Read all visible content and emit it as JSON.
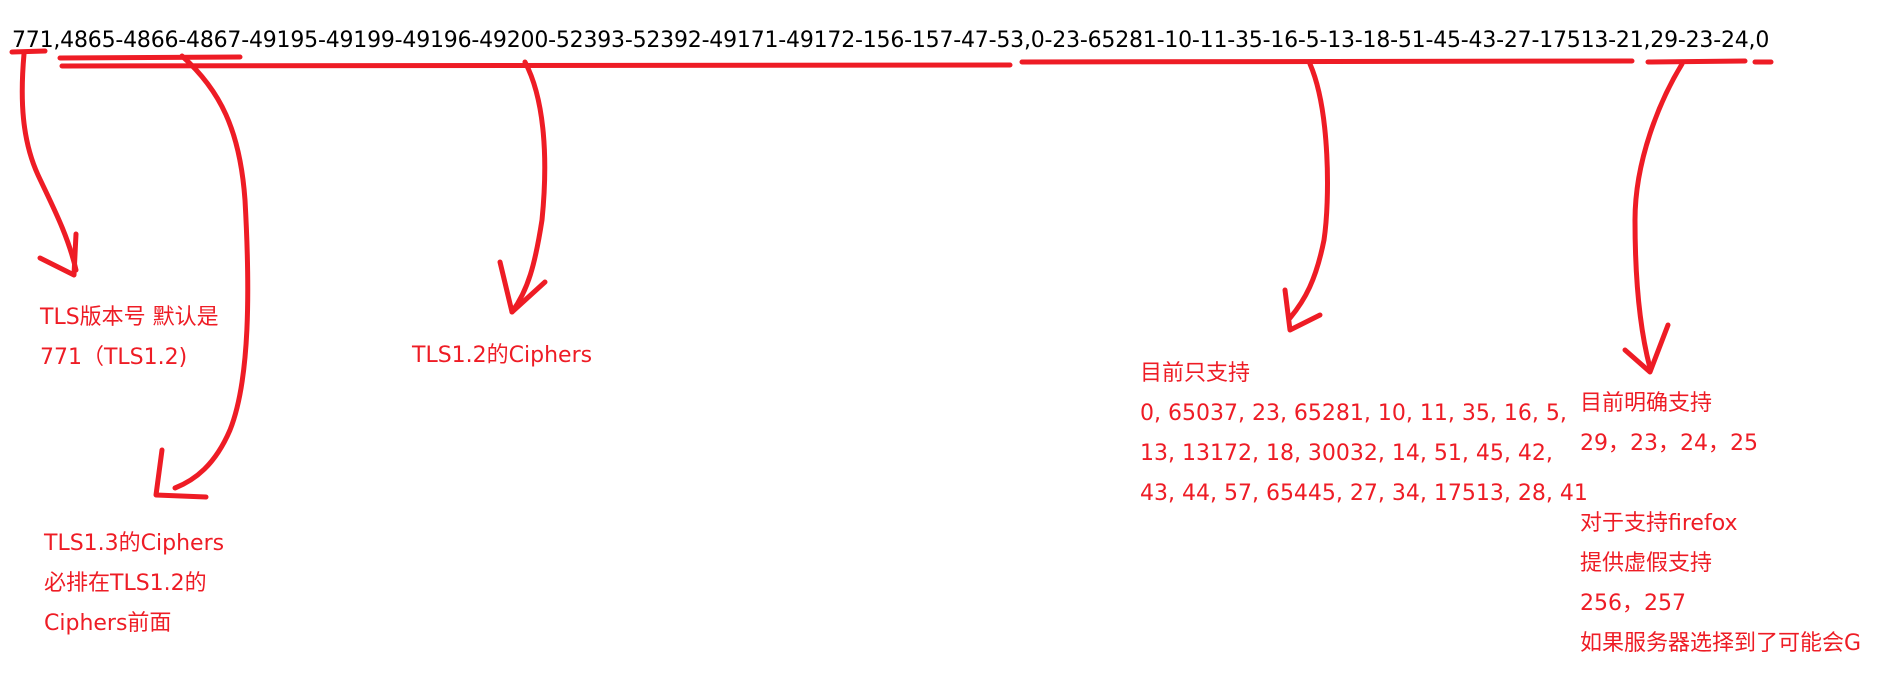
{
  "fingerprint": "771,4865-4866-4867-49195-49199-49196-49200-52393-52392-49171-49172-156-157-47-53,0-23-65281-10-11-35-16-5-13-18-51-45-43-27-17513-21,29-23-24,0",
  "annotations": {
    "version": {
      "lines": [
        "TLS版本号 默认是",
        "771（TLS1.2)"
      ]
    },
    "tls13_ciphers": {
      "lines": [
        "TLS1.3的Ciphers",
        "必排在TLS1.2的",
        "Ciphers前面"
      ]
    },
    "tls12_ciphers": {
      "lines": [
        "TLS1.2的Ciphers"
      ]
    },
    "extensions": {
      "lines": [
        "目前只支持",
        "0, 65037, 23, 65281, 10, 11, 35, 16, 5,",
        "13, 13172, 18, 30032, 14, 51, 45, 42,",
        "43, 44, 57, 65445, 27, 34, 17513, 28, 41"
      ]
    },
    "curves": {
      "lines": [
        "目前明确支持",
        "29，23，24，25",
        "",
        "对于支持firefox",
        "提供虚假支持",
        "256，257",
        "如果服务器选择到了可能会G"
      ]
    }
  },
  "colors": {
    "annotation": "#ee1c25",
    "text": "#000000",
    "background": "#ffffff"
  }
}
